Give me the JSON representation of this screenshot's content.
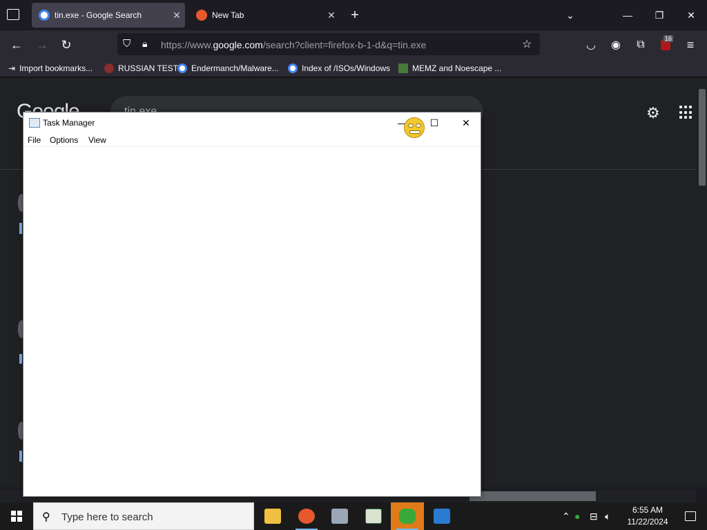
{
  "browser": {
    "tabs": [
      {
        "title": "tin.exe - Google Search",
        "active": true
      },
      {
        "title": "New Tab",
        "active": false
      }
    ],
    "new_tab_label": "+",
    "url": {
      "prefix": "https://www.",
      "domain": "google.com",
      "path": "/search?client=firefox-b-1-d&q=tin.exe"
    },
    "extension_badge": "16",
    "bookmarks": [
      {
        "label": "Import bookmarks..."
      },
      {
        "label": "RUSSIAN TEST"
      },
      {
        "label": "Endermanch/Malware..."
      },
      {
        "label": "Index of /ISOs/Windows"
      },
      {
        "label": "MEMZ and Noescape ..."
      }
    ]
  },
  "google": {
    "logo": "Google",
    "query": "tin.exe"
  },
  "task_manager": {
    "title": "Task Manager",
    "menus": [
      "File",
      "Options",
      "View"
    ]
  },
  "taskbar": {
    "search_placeholder": "Type here to search",
    "time": "6:55 AM",
    "date": "11/22/2024",
    "apps": [
      "file-explorer",
      "firefox",
      "app-3",
      "app-4",
      "task-manager",
      "app-6"
    ]
  },
  "colors": {
    "browser_bg": "#1c1b22",
    "toolbar": "#2b2a33",
    "page_bg": "#202124",
    "active_task": "#e07b1a"
  }
}
